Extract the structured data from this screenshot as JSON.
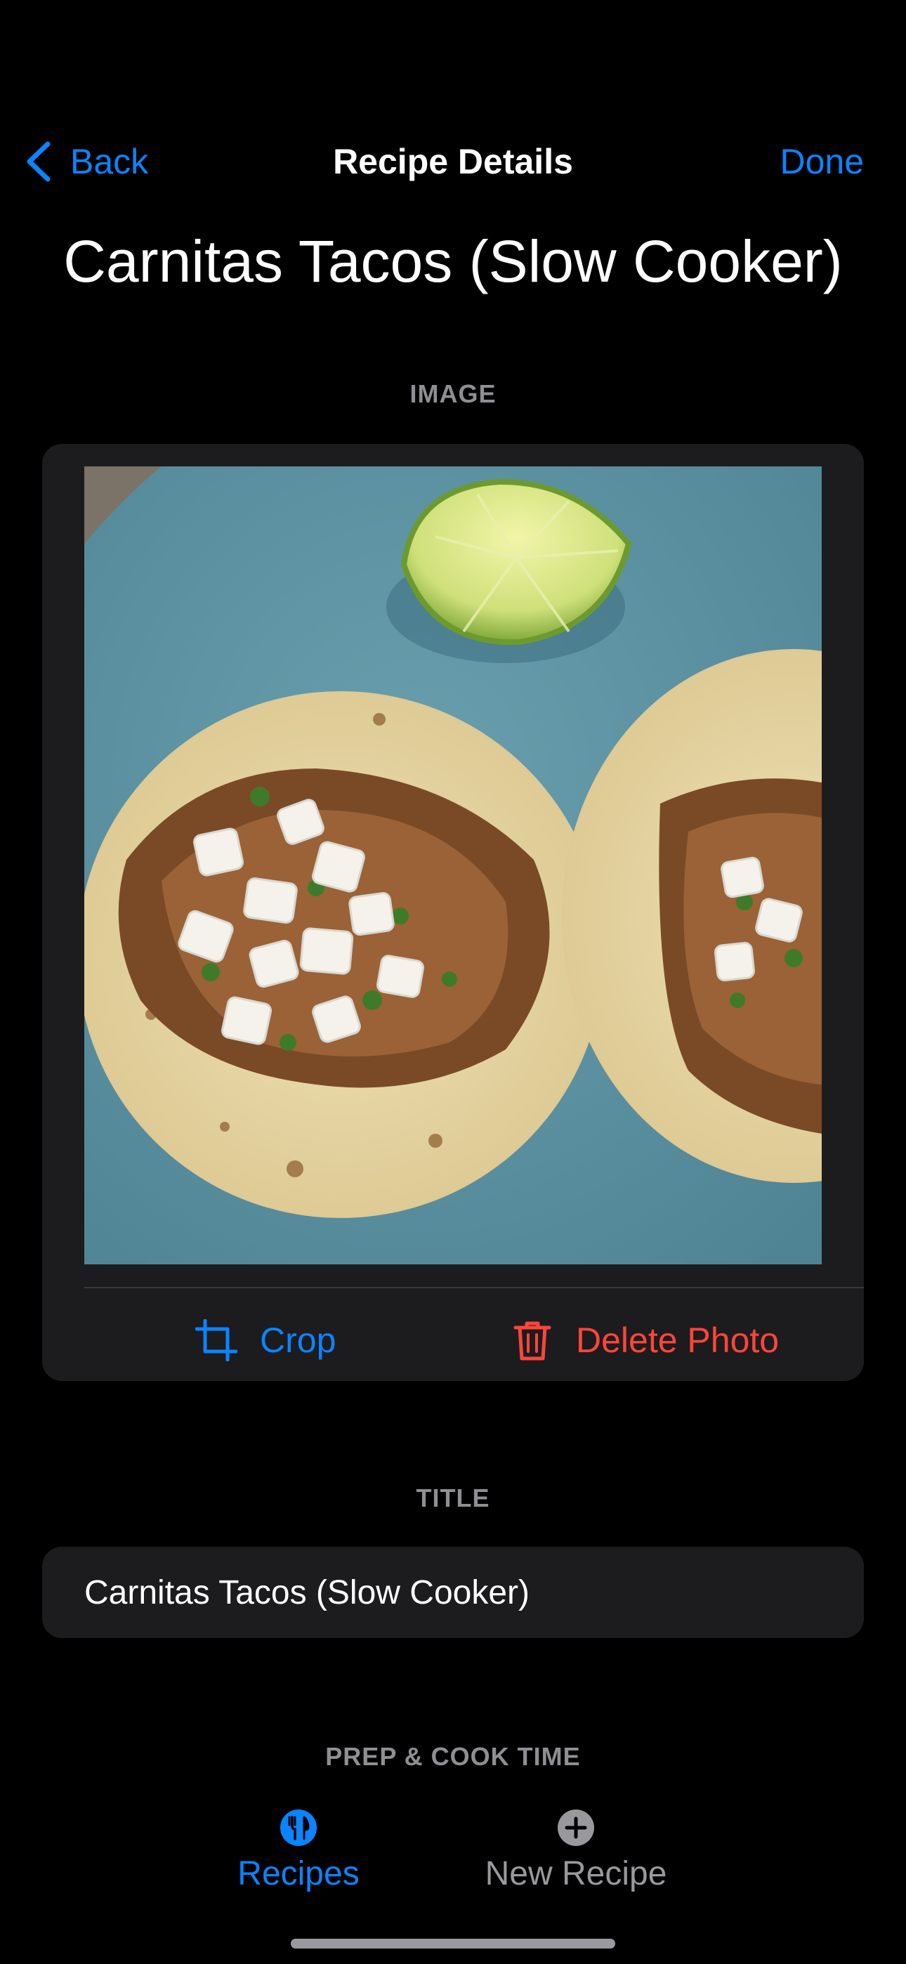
{
  "nav": {
    "back_label": "Back",
    "title": "Recipe Details",
    "done_label": "Done"
  },
  "recipe": {
    "heading": "Carnitas Tacos (Slow Cooker)"
  },
  "sections": {
    "image_header": "IMAGE",
    "title_header": "TITLE",
    "time_header": "PREP & COOK TIME"
  },
  "image_card": {
    "crop_label": "Crop",
    "delete_label": "Delete Photo"
  },
  "title_field": {
    "value": "Carnitas Tacos (Slow Cooker)"
  },
  "tabs": [
    {
      "label": "Recipes",
      "icon": "fork-knife-icon",
      "selected": true
    },
    {
      "label": "New Recipe",
      "icon": "plus-circle-icon",
      "selected": false
    }
  ],
  "colors": {
    "accent": "#0a84ff",
    "destructive": "#ff453a",
    "background": "#000000",
    "card": "#1c1c1e",
    "secondary_text": "#8e8e93"
  }
}
